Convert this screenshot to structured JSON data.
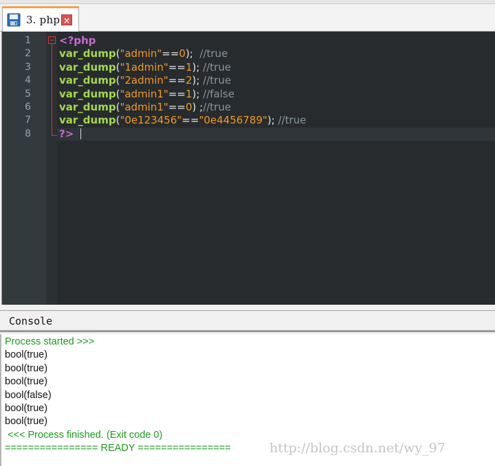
{
  "tab": {
    "title": "3. php",
    "close_glyph": "×",
    "icon": "file-icon"
  },
  "editor": {
    "line_numbers": [
      "1",
      "2",
      "3",
      "4",
      "5",
      "6",
      "7",
      "8"
    ],
    "lines": [
      [
        {
          "t": "<?php",
          "c": "kw"
        }
      ],
      [
        {
          "t": "var_dump",
          "c": "fn"
        },
        {
          "t": "(",
          "c": "pn"
        },
        {
          "t": "\"admin\"",
          "c": "str"
        },
        {
          "t": "==",
          "c": "pn"
        },
        {
          "t": "0",
          "c": "num"
        },
        {
          "t": ");  ",
          "c": "pn"
        },
        {
          "t": "//true",
          "c": "cmt"
        }
      ],
      [
        {
          "t": "var_dump",
          "c": "fn"
        },
        {
          "t": "(",
          "c": "pn"
        },
        {
          "t": "\"1admin\"",
          "c": "str"
        },
        {
          "t": "==",
          "c": "pn"
        },
        {
          "t": "1",
          "c": "num"
        },
        {
          "t": "); ",
          "c": "pn"
        },
        {
          "t": "//true",
          "c": "cmt"
        }
      ],
      [
        {
          "t": "var_dump",
          "c": "fn"
        },
        {
          "t": "(",
          "c": "pn"
        },
        {
          "t": "\"2admin\"",
          "c": "str"
        },
        {
          "t": "==",
          "c": "pn"
        },
        {
          "t": "2",
          "c": "num"
        },
        {
          "t": "); ",
          "c": "pn"
        },
        {
          "t": "//true",
          "c": "cmt"
        }
      ],
      [
        {
          "t": "var_dump",
          "c": "fn"
        },
        {
          "t": "(",
          "c": "pn"
        },
        {
          "t": "\"admin1\"",
          "c": "str"
        },
        {
          "t": "==",
          "c": "pn"
        },
        {
          "t": "1",
          "c": "num"
        },
        {
          "t": "); ",
          "c": "pn"
        },
        {
          "t": "//false",
          "c": "cmt"
        }
      ],
      [
        {
          "t": "var_dump",
          "c": "fn"
        },
        {
          "t": "(",
          "c": "pn"
        },
        {
          "t": "\"admin1\"",
          "c": "str"
        },
        {
          "t": "==",
          "c": "pn"
        },
        {
          "t": "0",
          "c": "num"
        },
        {
          "t": ") ;",
          "c": "pn"
        },
        {
          "t": "//true",
          "c": "cmt"
        }
      ],
      [
        {
          "t": "var_dump",
          "c": "fn"
        },
        {
          "t": "(",
          "c": "pn"
        },
        {
          "t": "\"0e123456\"",
          "c": "str"
        },
        {
          "t": "==",
          "c": "pn"
        },
        {
          "t": "\"0e4456789\"",
          "c": "str"
        },
        {
          "t": "); ",
          "c": "pn"
        },
        {
          "t": "//true",
          "c": "cmt"
        }
      ],
      [
        {
          "t": "?>",
          "c": "kw"
        }
      ]
    ]
  },
  "console": {
    "title": "Console",
    "lines": [
      {
        "text": "Process started >>>",
        "color": "green"
      },
      {
        "text": "bool(true)",
        "color": "black"
      },
      {
        "text": "bool(true)",
        "color": "black"
      },
      {
        "text": "bool(true)",
        "color": "black"
      },
      {
        "text": "bool(false)",
        "color": "black"
      },
      {
        "text": "bool(true)",
        "color": "black"
      },
      {
        "text": "bool(true)",
        "color": "black"
      },
      {
        "text": " <<< Process finished. (Exit code 0)",
        "color": "green"
      },
      {
        "text": "================ READY ================",
        "color": "green"
      }
    ],
    "watermark": "http://blog.csdn.net/wy_97"
  },
  "colors": {
    "editor_bg": "#272b2e",
    "keyword": "#c86bd1",
    "function": "#a6d94a",
    "string": "#f39a1e",
    "comment": "#8a959b",
    "console_green": "#1c9a1c",
    "tab_accent": "#f3a24a"
  }
}
